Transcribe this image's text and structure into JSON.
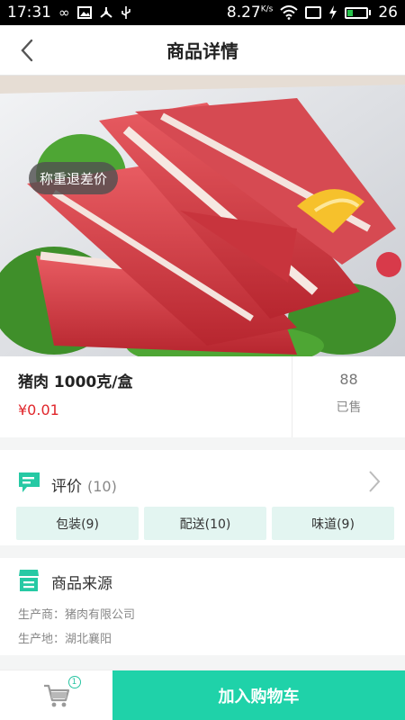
{
  "status_bar": {
    "time": "17:31",
    "speed": "8.27",
    "speed_unit": "K/s",
    "battery": "26",
    "icons": [
      "infinity-icon",
      "image-icon",
      "usb-share-icon",
      "usb-icon",
      "wifi-icon",
      "screen-icon",
      "charging-icon",
      "battery-icon"
    ]
  },
  "nav": {
    "title": "商品详情",
    "back_icon": "back-arrow-icon"
  },
  "hero": {
    "tag": "称重退差价"
  },
  "product": {
    "name": "猪肉 1000克/盒",
    "price": "¥0.01",
    "sold_count": "88",
    "sold_label": "已售"
  },
  "review": {
    "title": "评价",
    "count": "(10)",
    "tags": [
      "包装(9)",
      "配送(10)",
      "味道(9)"
    ]
  },
  "origin": {
    "title": "商品来源",
    "producer_label": "生产商：",
    "producer": "猪肉有限公司",
    "place_label": "生产地：",
    "place": "湖北襄阳"
  },
  "bottom": {
    "cart_count": "1",
    "add_to_cart": "加入购物车"
  },
  "colors": {
    "accent": "#1fd2a9",
    "price": "#e0262b",
    "tag_bg": "#e3f5f1"
  }
}
